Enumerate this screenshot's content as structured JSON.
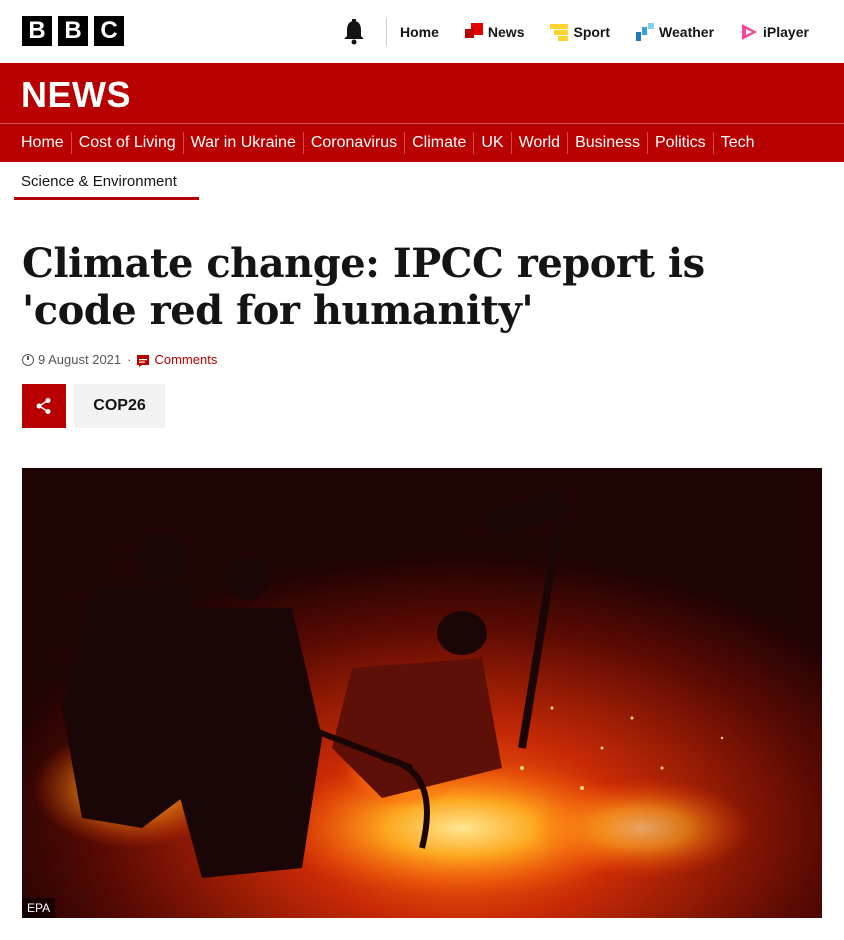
{
  "brand": {
    "letters": [
      "B",
      "B",
      "C"
    ]
  },
  "top_nav": [
    {
      "label": "Home",
      "icon": "none"
    },
    {
      "label": "News",
      "icon": "news-icon",
      "color": "#e50000"
    },
    {
      "label": "Sport",
      "icon": "sport-icon",
      "color": "#ffd230"
    },
    {
      "label": "Weather",
      "icon": "weather-icon",
      "color": "#1d7ab8"
    },
    {
      "label": "iPlayer",
      "icon": "iplayer-icon",
      "color": "#f54996"
    }
  ],
  "banner": {
    "title": "NEWS",
    "color": "#b80000"
  },
  "sub_nav": [
    "Home",
    "Cost of Living",
    "War in Ukraine",
    "Coronavirus",
    "Climate",
    "UK",
    "World",
    "Business",
    "Politics",
    "Tech"
  ],
  "section": {
    "label": "Science & Environment"
  },
  "article": {
    "headline": "Climate change: IPCC report is 'code red for humanity'",
    "date": "9 August 2021",
    "separator": "·",
    "comments_label": "Comments",
    "tag": "COP26",
    "image_credit": "EPA"
  }
}
